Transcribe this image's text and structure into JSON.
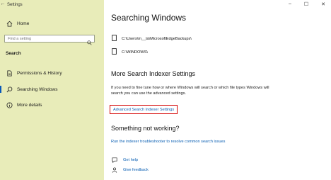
{
  "window": {
    "title": "Settings",
    "controls": {
      "minimize": "–",
      "maximize": "☐",
      "close": "✕"
    },
    "back_glyph": "←"
  },
  "sidebar": {
    "home_label": "Home",
    "search_placeholder": "Find a setting",
    "section_label": "Search",
    "items": [
      {
        "label": "Permissions & History",
        "icon": "permissions-icon"
      },
      {
        "label": "Searching Windows",
        "icon": "search-icon",
        "active": true
      },
      {
        "label": "More details",
        "icon": "info-icon"
      }
    ]
  },
  "main": {
    "title": "Searching Windows",
    "paths": [
      "C:\\Users\\m__la\\MicrosoftEdgeBackups\\",
      "C:\\WINDOWS\\"
    ],
    "indexer_heading": "More Search Indexer Settings",
    "indexer_description": "If you need to fine tune how or where Windows will search or which file types Windows will search you can use the advanced settings.",
    "advanced_link": "Advanced Search Indexer Settings",
    "trouble_heading": "Something not working?",
    "troubleshooter_link": "Run the indexer troubleshooter to resolve common search issues",
    "get_help": "Get help",
    "give_feedback": "Give feedback"
  },
  "colors": {
    "sidebar_bg": "#e8ecb9",
    "link": "#0a5fb3",
    "highlight_border": "#d40000",
    "active_indicator": "#0a58b8"
  }
}
